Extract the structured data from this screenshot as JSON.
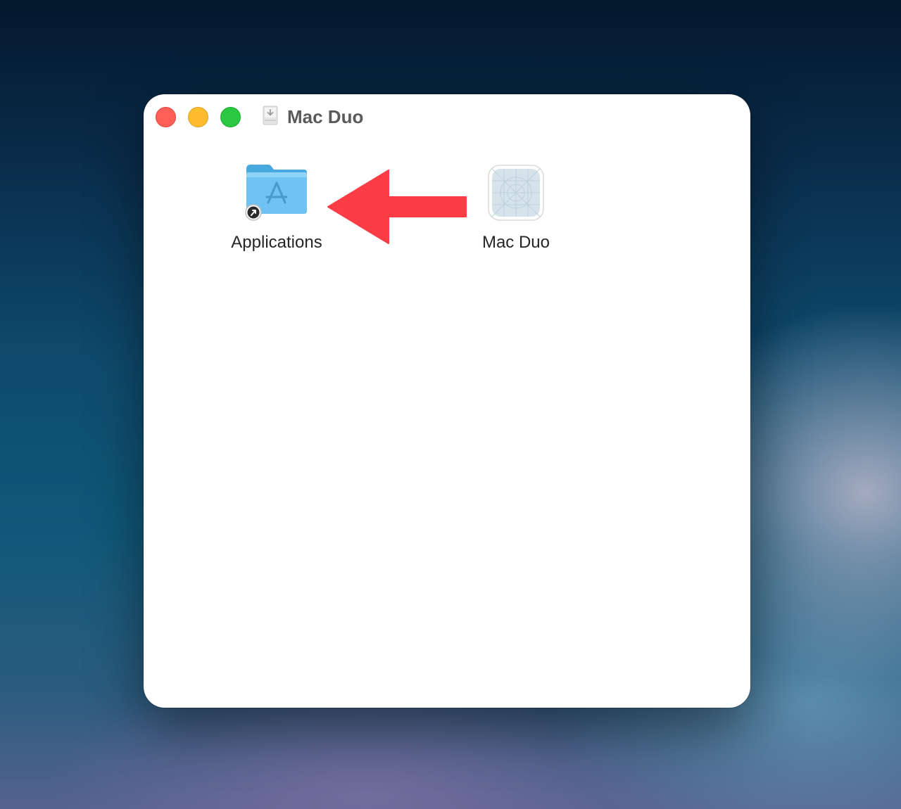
{
  "window": {
    "title": "Mac Duo",
    "title_icon": "disk-image-icon"
  },
  "traffic_lights": {
    "close_color": "#ff5f57",
    "minimize_color": "#febc2e",
    "maximize_color": "#28c840"
  },
  "items": {
    "applications": {
      "label": "Applications",
      "icon": "applications-folder-alias-icon",
      "color": "#5ac8fa"
    },
    "app": {
      "label": "Mac Duo",
      "icon": "app-placeholder-icon"
    }
  },
  "annotation": {
    "icon": "arrow-left-icon",
    "color": "#fc3d46"
  }
}
